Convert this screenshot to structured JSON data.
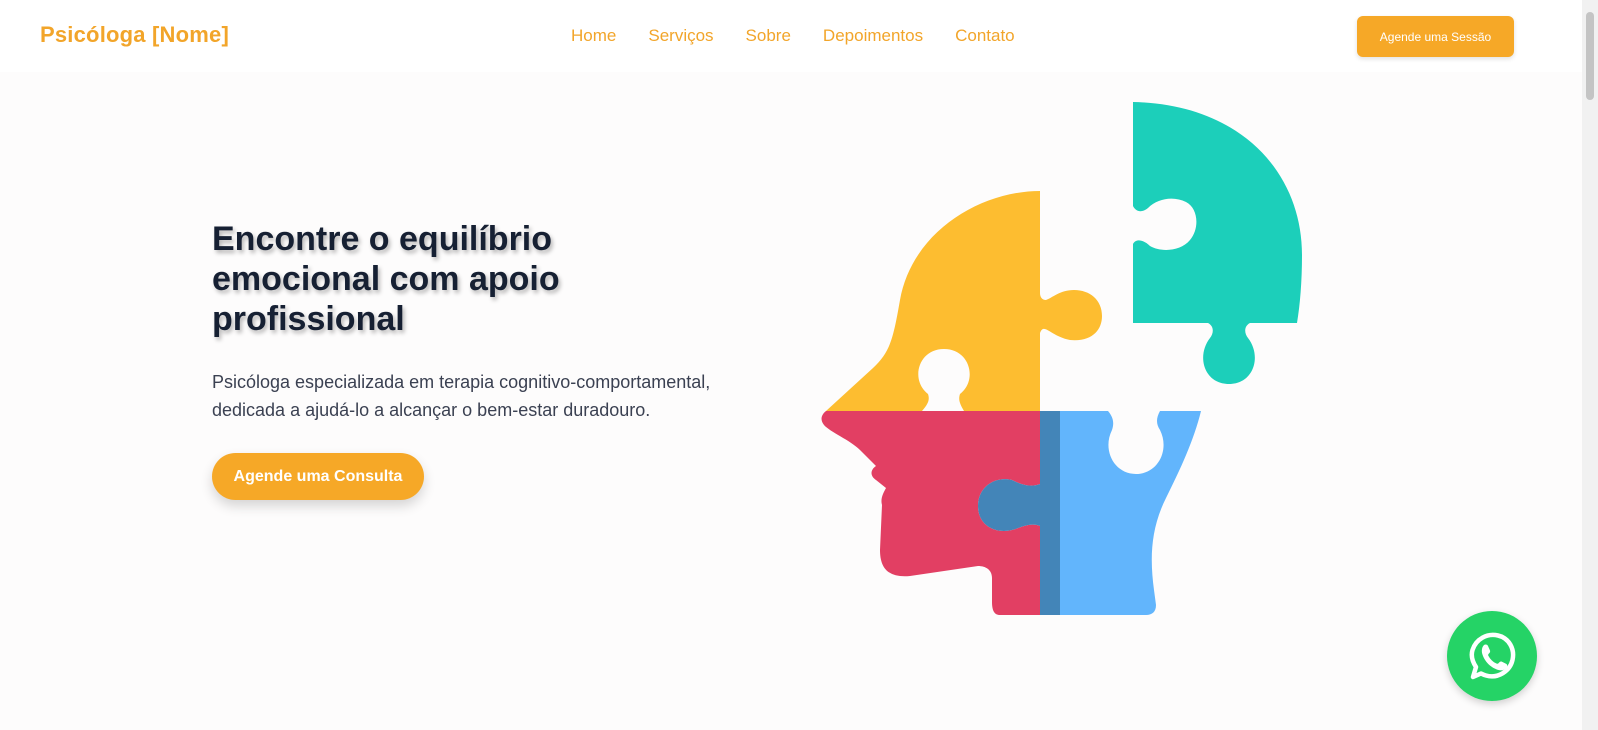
{
  "header": {
    "brand": "Psicóloga [Nome]",
    "nav": [
      "Home",
      "Serviços",
      "Sobre",
      "Depoimentos",
      "Contato"
    ],
    "cta_label": "Agende uma Sessão"
  },
  "hero": {
    "title": "Encontre o equilíbrio emocional com apoio profissional",
    "description": "Psicóloga especializada em terapia cognitivo-comportamental, dedicada a ajudá-lo a alcançar o bem-estar duradouro.",
    "cta_label": "Agende uma Consulta",
    "illustration_icon": "puzzle-head-illustration"
  },
  "floating": {
    "whatsapp_icon": "whatsapp-icon"
  },
  "colors": {
    "accent": "#f6a827",
    "title": "#162033",
    "puzzle_yellow": "#fdbd30",
    "puzzle_teal": "#1ccfba",
    "puzzle_red": "#e23f63",
    "puzzle_blue": "#62b5fc",
    "puzzle_blue_dark": "#4385b8",
    "whatsapp_green": "#25d366"
  }
}
